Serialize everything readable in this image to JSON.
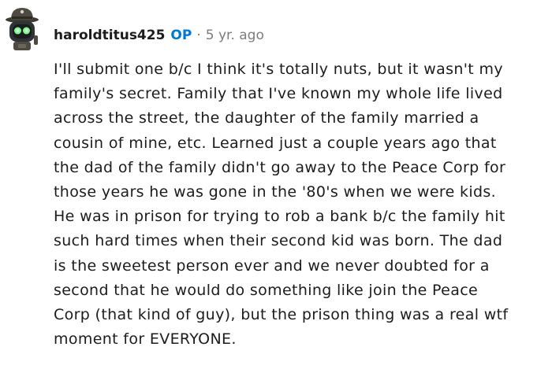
{
  "comment": {
    "username": "haroldtitus425",
    "op_badge": "OP",
    "separator": "·",
    "timestamp": "5 yr. ago",
    "avatar_icon": "robot-avatar-icon",
    "lines": [
      "I'll submit one b/c I think it's totally nuts, but it wasn't my",
      "family's secret. Family that I've known my whole life lived",
      "across the street, the daughter of the family married a",
      "cousin of mine, etc. Learned just a couple years ago that",
      "the dad of the family didn't go away to the Peace Corp for",
      "those years he was gone in the '80's when we were kids.",
      "He was in prison for trying to rob a bank b/c the family hit",
      "such hard times when their second kid was born. The dad",
      "is the sweetest person ever and we never doubted for a",
      "second that he would do something like join the Peace",
      "Corp (that kind of guy), but the prison thing was a real wtf",
      "moment for EVERYONE."
    ]
  },
  "colors": {
    "text": "#1c1c1c",
    "op_accent": "#0079d3",
    "meta": "#7c7c7c",
    "background": "#ffffff"
  }
}
